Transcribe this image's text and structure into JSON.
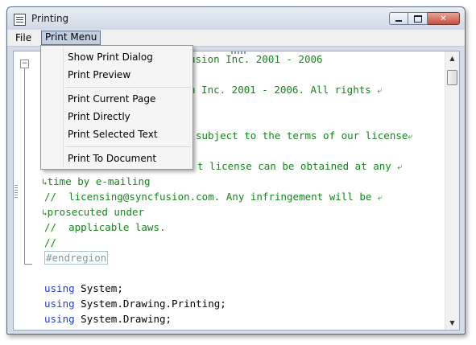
{
  "window": {
    "title": "Printing"
  },
  "menubar": {
    "items": [
      {
        "label": "File"
      },
      {
        "label": "Print Menu"
      }
    ]
  },
  "print_menu": {
    "items": [
      {
        "label": "Show Print Dialog"
      },
      {
        "label": "Print Preview"
      },
      {
        "label": "Print Current Page"
      },
      {
        "label": "Print Directly"
      },
      {
        "label": "Print Selected Text"
      },
      {
        "label": "Print To Document"
      }
    ]
  },
  "editor": {
    "visible_lines": [
      "usion Inc. 2001 - 2006",
      "n Inc. 2001 - 2006. All rights",
      "subject to the terms of our license",
      "t license can be obtained at any",
      "time by e-mailing",
      "//  licensing@syncfusion.com. Any infringement will be",
      "prosecuted under",
      "//  applicable laws.",
      "//",
      "#endregion",
      "using",
      " System;",
      "using",
      " System.Drawing.Printing;",
      "using",
      " System.Drawing;"
    ],
    "wrap_glyph": "⤶",
    "continuation_glyph": "↳"
  },
  "icons": {
    "app": "document-icon",
    "fold": "collapse-minus-icon",
    "scroll_up": "arrow-up-icon",
    "scroll_down": "arrow-down-icon"
  },
  "colors": {
    "comment": "#14861b",
    "keyword": "#1f3fd0",
    "region": "#6f8a8a",
    "menu_highlight": "#c2cde0"
  }
}
